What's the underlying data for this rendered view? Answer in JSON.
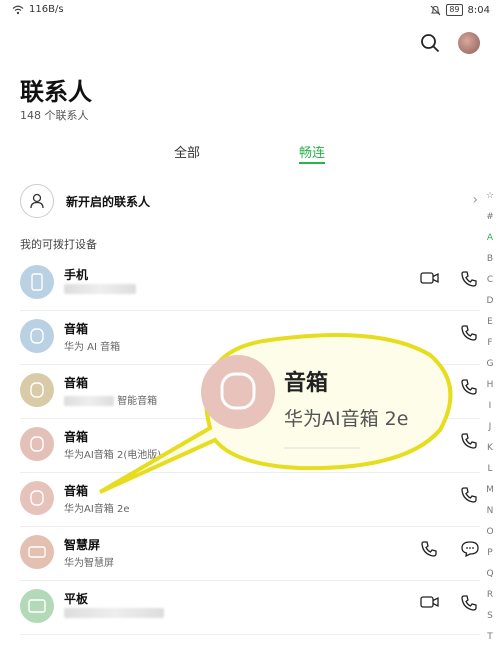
{
  "status_bar": {
    "network_speed": "116B/s",
    "battery": "89",
    "time": "8:04"
  },
  "header": {
    "title": "联系人",
    "subtitle": "148 个联系人"
  },
  "tabs": [
    {
      "label": "全部"
    },
    {
      "label": "畅连"
    }
  ],
  "new_contacts": {
    "label": "新开启的联系人"
  },
  "section_title": "我的可拨打设备",
  "devices": [
    {
      "name": "手机",
      "desc": ""
    },
    {
      "name": "音箱",
      "desc": "华为 AI 音箱"
    },
    {
      "name": "音箱",
      "desc": "智能音箱"
    },
    {
      "name": "音箱",
      "desc": "华为AI音箱 2(电池版)"
    },
    {
      "name": "音箱",
      "desc": "华为AI音箱 2e"
    },
    {
      "name": "智慧屏",
      "desc": "华为智慧屏"
    },
    {
      "name": "平板",
      "desc": ""
    }
  ],
  "alphabet_index": [
    "☆",
    "#",
    "A",
    "B",
    "C",
    "D",
    "E",
    "F",
    "G",
    "H",
    "I",
    "J",
    "K",
    "L",
    "M",
    "N",
    "O",
    "P",
    "Q",
    "R",
    "S",
    "T"
  ],
  "callout": {
    "title": "音箱",
    "subtitle": "华为AI音箱 2e"
  },
  "colors": {
    "accent": "#2bb24c",
    "callout_border": "#e6dd1f",
    "callout_fill": "#fdfde9"
  }
}
